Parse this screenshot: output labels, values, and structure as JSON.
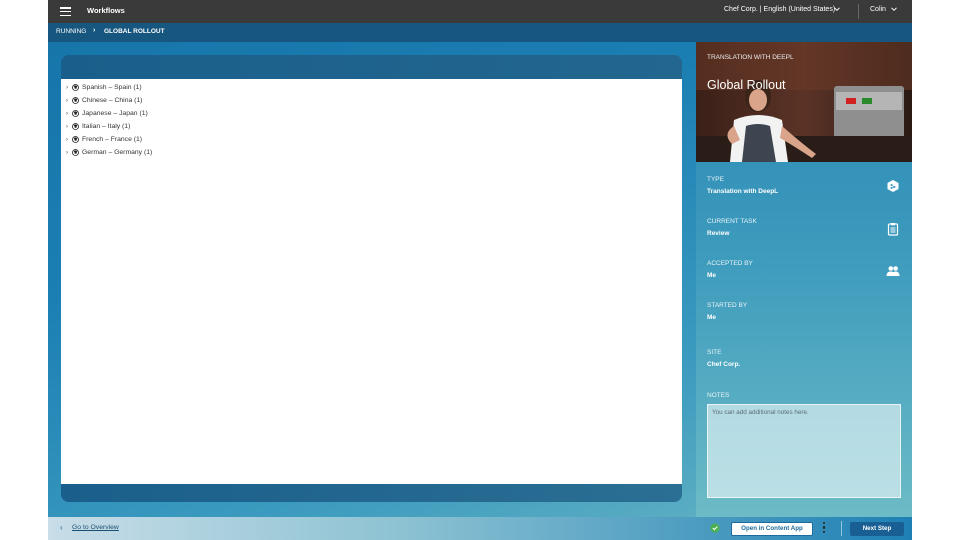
{
  "topbar": {
    "title": "Workflows",
    "workspace": "Chef Corp. | English (United States)",
    "user": "Colin",
    "menu_icon": "hamburger-icon",
    "chevron_icon": "chevron-down-icon"
  },
  "breadcrumb": {
    "parent": "RUNNING",
    "separator": "›",
    "current": "GLOBAL ROLLOUT"
  },
  "tree": {
    "items": [
      {
        "label": "Spanish – Spain (1)"
      },
      {
        "label": "Chinese – China (1)"
      },
      {
        "label": "Japanese – Japan (1)"
      },
      {
        "label": "Italian – Italy (1)"
      },
      {
        "label": "French – France (1)"
      },
      {
        "label": "German – Germany (1)"
      }
    ],
    "chevron": "›",
    "item_icon": "globe-icon"
  },
  "side": {
    "subtitle": "TRANSLATION WITH DEEPL",
    "title": "Global Rollout",
    "fields": [
      {
        "label": "TYPE",
        "value": "Translation with DeepL",
        "icon": "deepl-icon"
      },
      {
        "label": "CURRENT TASK",
        "value": "Review",
        "icon": "clipboard-icon"
      },
      {
        "label": "ACCEPTED BY",
        "value": "Me",
        "icon": "users-icon"
      },
      {
        "label": "STARTED BY",
        "value": "Me"
      },
      {
        "label": "SITE",
        "value": "Chef Corp."
      }
    ],
    "notes_label": "NOTES",
    "notes_placeholder": "You can add additional notes here."
  },
  "bottombar": {
    "back_chevron": "‹",
    "overview_link": "Go to Overview",
    "open_button": "Open in Content App",
    "next_button": "Next Step"
  },
  "colors": {
    "topbar": "#3a3a3a",
    "breadcrumb": "#17567e",
    "primary_button": "#195f94",
    "check": "#4caf50"
  }
}
